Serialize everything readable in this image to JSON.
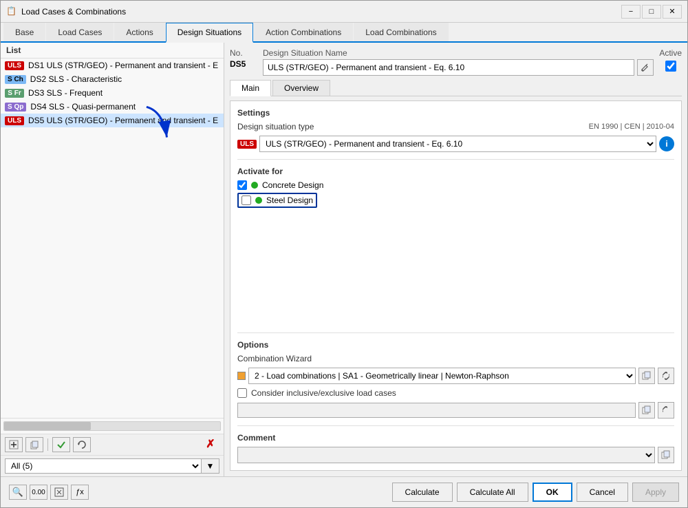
{
  "window": {
    "title": "Load Cases & Combinations",
    "icon": "📋"
  },
  "tabs": {
    "main": [
      {
        "id": "base",
        "label": "Base"
      },
      {
        "id": "load-cases",
        "label": "Load Cases"
      },
      {
        "id": "actions",
        "label": "Actions"
      },
      {
        "id": "design-situations",
        "label": "Design Situations"
      },
      {
        "id": "action-combinations",
        "label": "Action Combinations"
      },
      {
        "id": "load-combinations",
        "label": "Load Combinations"
      }
    ],
    "active": "design-situations"
  },
  "list": {
    "header": "List",
    "items": [
      {
        "id": "DS1",
        "tag": "ULS",
        "tag_type": "uls",
        "text": "DS1  ULS (STR/GEO) - Permanent and transient - E"
      },
      {
        "id": "DS2",
        "tag": "S Ch",
        "tag_type": "sch",
        "text": "DS2  SLS - Characteristic"
      },
      {
        "id": "DS3",
        "tag": "S Fr",
        "tag_type": "sfr",
        "text": "DS3  SLS - Frequent"
      },
      {
        "id": "DS4",
        "tag": "S Qp",
        "tag_type": "sqp",
        "text": "DS4  SLS - Quasi-permanent"
      },
      {
        "id": "DS5",
        "tag": "ULS",
        "tag_type": "uls",
        "text": "DS5  ULS (STR/GEO) - Permanent and transient - E"
      }
    ],
    "filter": {
      "value": "All (5)",
      "options": [
        "All (5)"
      ]
    }
  },
  "toolbar": {
    "left_buttons": [
      "➕",
      "📋",
      "✓",
      "🔄",
      "✗"
    ]
  },
  "right_panel": {
    "no_label": "No.",
    "no_value": "DS5",
    "design_situation_name_label": "Design Situation Name",
    "design_situation_name_value": "ULS (STR/GEO) - Permanent and transient - Eq. 6.10",
    "active_label": "Active",
    "active_checked": true
  },
  "sub_tabs": [
    {
      "id": "main",
      "label": "Main"
    },
    {
      "id": "overview",
      "label": "Overview"
    }
  ],
  "sub_tab_active": "main",
  "settings": {
    "section_title": "Settings",
    "design_situation_type_label": "Design situation type",
    "design_situation_type_value": "EN 1990 | CEN | 2010-04",
    "dropdown_tag": "ULS",
    "dropdown_value": "ULS (STR/GEO) - Permanent and transient - Eq. 6.10"
  },
  "activate_for": {
    "section_title": "Activate for",
    "items": [
      {
        "label": "Concrete Design",
        "checked": true,
        "highlighted": false
      },
      {
        "label": "Steel Design",
        "checked": false,
        "highlighted": true
      }
    ]
  },
  "options": {
    "section_title": "Options",
    "combination_wizard_label": "Combination Wizard",
    "combination_wizard_value": "2 - Load combinations | SA1 - Geometrically linear | Newton-Raphson",
    "consider_inclusive_label": "Consider inclusive/exclusive load cases",
    "consider_inclusive_checked": false
  },
  "comment": {
    "section_title": "Comment",
    "value": ""
  },
  "bottom_bar": {
    "calculate_label": "Calculate",
    "calculate_all_label": "Calculate All",
    "ok_label": "OK",
    "cancel_label": "Cancel",
    "apply_label": "Apply"
  }
}
